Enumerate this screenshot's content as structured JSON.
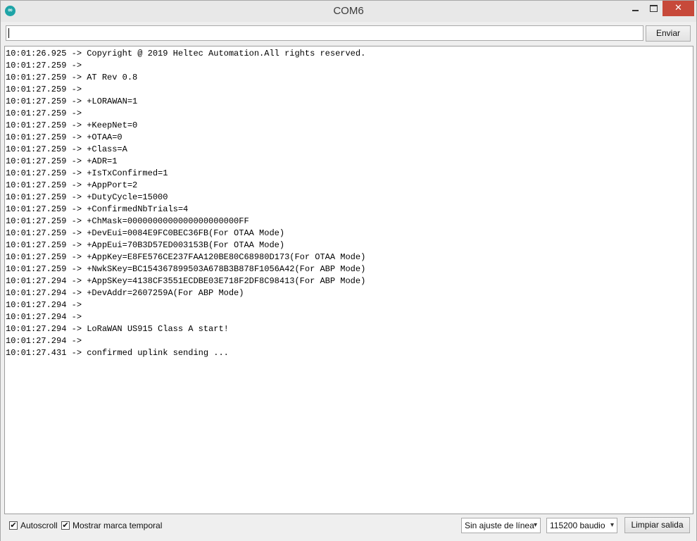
{
  "window": {
    "title": "COM6",
    "icon_name": "arduino-icon",
    "icon_glyph": "∞",
    "minimize_icon": "minimize-icon",
    "maximize_icon": "maximize-icon",
    "close_icon": "close-icon",
    "close_glyph": "✕",
    "close_color": "#c7493a"
  },
  "command": {
    "value": "",
    "send_label": "Enviar"
  },
  "output": {
    "lines": [
      "10:01:26.925 -> Copyright @ 2019 Heltec Automation.All rights reserved.",
      "10:01:27.259 -> ",
      "10:01:27.259 -> AT Rev 0.8",
      "10:01:27.259 -> ",
      "10:01:27.259 -> +LORAWAN=1",
      "10:01:27.259 -> ",
      "10:01:27.259 -> +KeepNet=0",
      "10:01:27.259 -> +OTAA=0",
      "10:01:27.259 -> +Class=A",
      "10:01:27.259 -> +ADR=1",
      "10:01:27.259 -> +IsTxConfirmed=1",
      "10:01:27.259 -> +AppPort=2",
      "10:01:27.259 -> +DutyCycle=15000",
      "10:01:27.259 -> +ConfirmedNbTrials=4",
      "10:01:27.259 -> +ChMask=0000000000000000000000FF",
      "10:01:27.259 -> +DevEui=0084E9FC0BEC36FB(For OTAA Mode)",
      "10:01:27.259 -> +AppEui=70B3D57ED003153B(For OTAA Mode)",
      "10:01:27.259 -> +AppKey=E8FE576CE237FAA120BE80C68980D173(For OTAA Mode)",
      "10:01:27.259 -> +NwkSKey=BC154367899503A678B3B878F1056A42(For ABP Mode)",
      "10:01:27.294 -> +AppSKey=4138CF3551ECDBE03E718F2DF8C98413(For ABP Mode)",
      "10:01:27.294 -> +DevAddr=2607259A(For ABP Mode)",
      "10:01:27.294 -> ",
      "10:01:27.294 -> ",
      "10:01:27.294 -> LoRaWAN US915 Class A start!",
      "10:01:27.294 -> ",
      "10:01:27.431 -> confirmed uplink sending ..."
    ]
  },
  "footer": {
    "autoscroll": {
      "label": "Autoscroll",
      "checked": true
    },
    "timestamp": {
      "label": "Mostrar marca temporal",
      "checked": true
    },
    "check_glyph": "✔",
    "line_ending": "Sin ajuste de línea",
    "baud_rate": "115200 baudio",
    "dropdown_glyph": "▾",
    "clear_label": "Limpiar salida"
  }
}
